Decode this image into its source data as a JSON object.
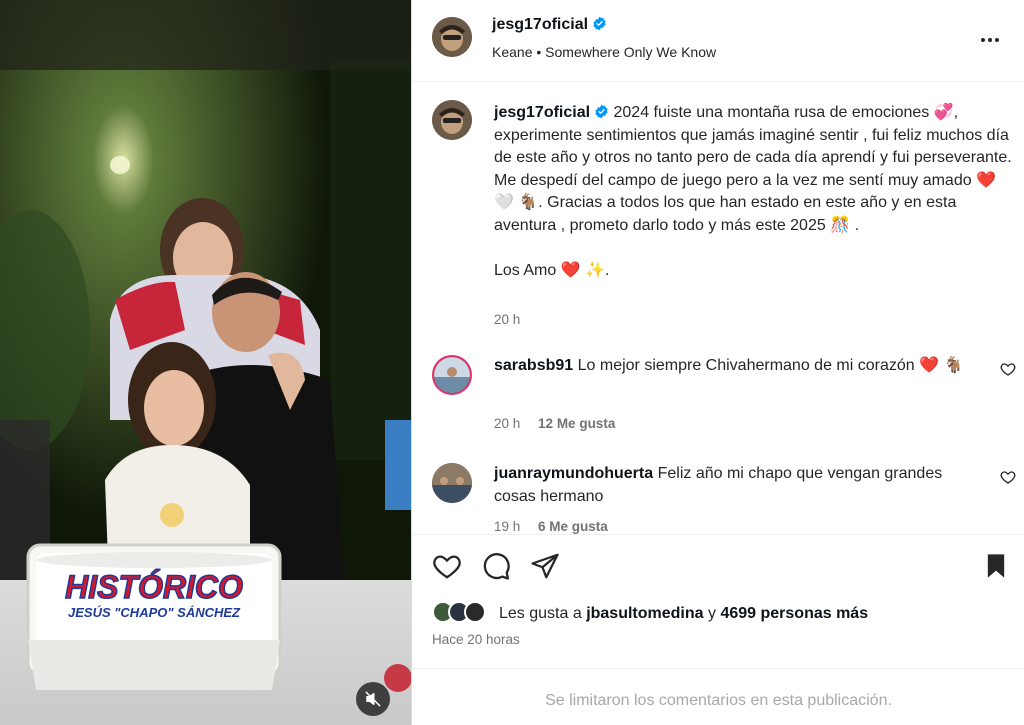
{
  "post": {
    "username": "jesg17oficial",
    "music": "Keane • Somewhere Only We Know",
    "caption": "2024 fuiste una montaña rusa de emociones 💞, experimente sentimientos que jamás imaginé sentir , fui feliz muchos día de este año y otros no tanto pero de cada día aprendí y fui perseverante. Me despedí del campo de juego pero a la vez me sentí muy amado ❤️ 🤍 🐐. Gracias a todos los que han estado en este año y en esta aventura , prometo darlo todo y más este 2025 🎊 .",
    "caption_signoff": "Los Amo ❤️ ✨.",
    "caption_time": "20 h",
    "cake_text_main": "HISTÓRICO",
    "cake_text_sub": "JESÚS \"CHAPO\" SÁNCHEZ"
  },
  "comments": [
    {
      "username": "sarabsb91",
      "text": "Lo mejor siempre Chivahermano de mi corazón ❤️ 🐐",
      "time": "20 h",
      "likes": "12 Me gusta"
    },
    {
      "username": "juanraymundohuerta",
      "text": "Feliz año mi chapo que vengan grandes cosas hermano",
      "time": "19 h",
      "likes": "6 Me gusta"
    }
  ],
  "actions": {
    "likes_prefix": "Les gusta a",
    "likes_user": "jbasultomedina",
    "likes_conj": "y",
    "likes_others": "4699 personas más",
    "posted": "Hace 20 horas"
  },
  "footer": {
    "limited": "Se limitaron los comentarios en esta publicación."
  },
  "colors": {
    "verified": "#0095f6",
    "text_primary": "#0f1419",
    "text_muted": "#737373"
  },
  "icons": [
    "verified-icon",
    "more-options-icon",
    "comment-like-heart-icon",
    "like-heart-icon",
    "comment-bubble-icon",
    "share-plane-icon",
    "save-bookmark-icon",
    "muted-speaker-icon"
  ]
}
